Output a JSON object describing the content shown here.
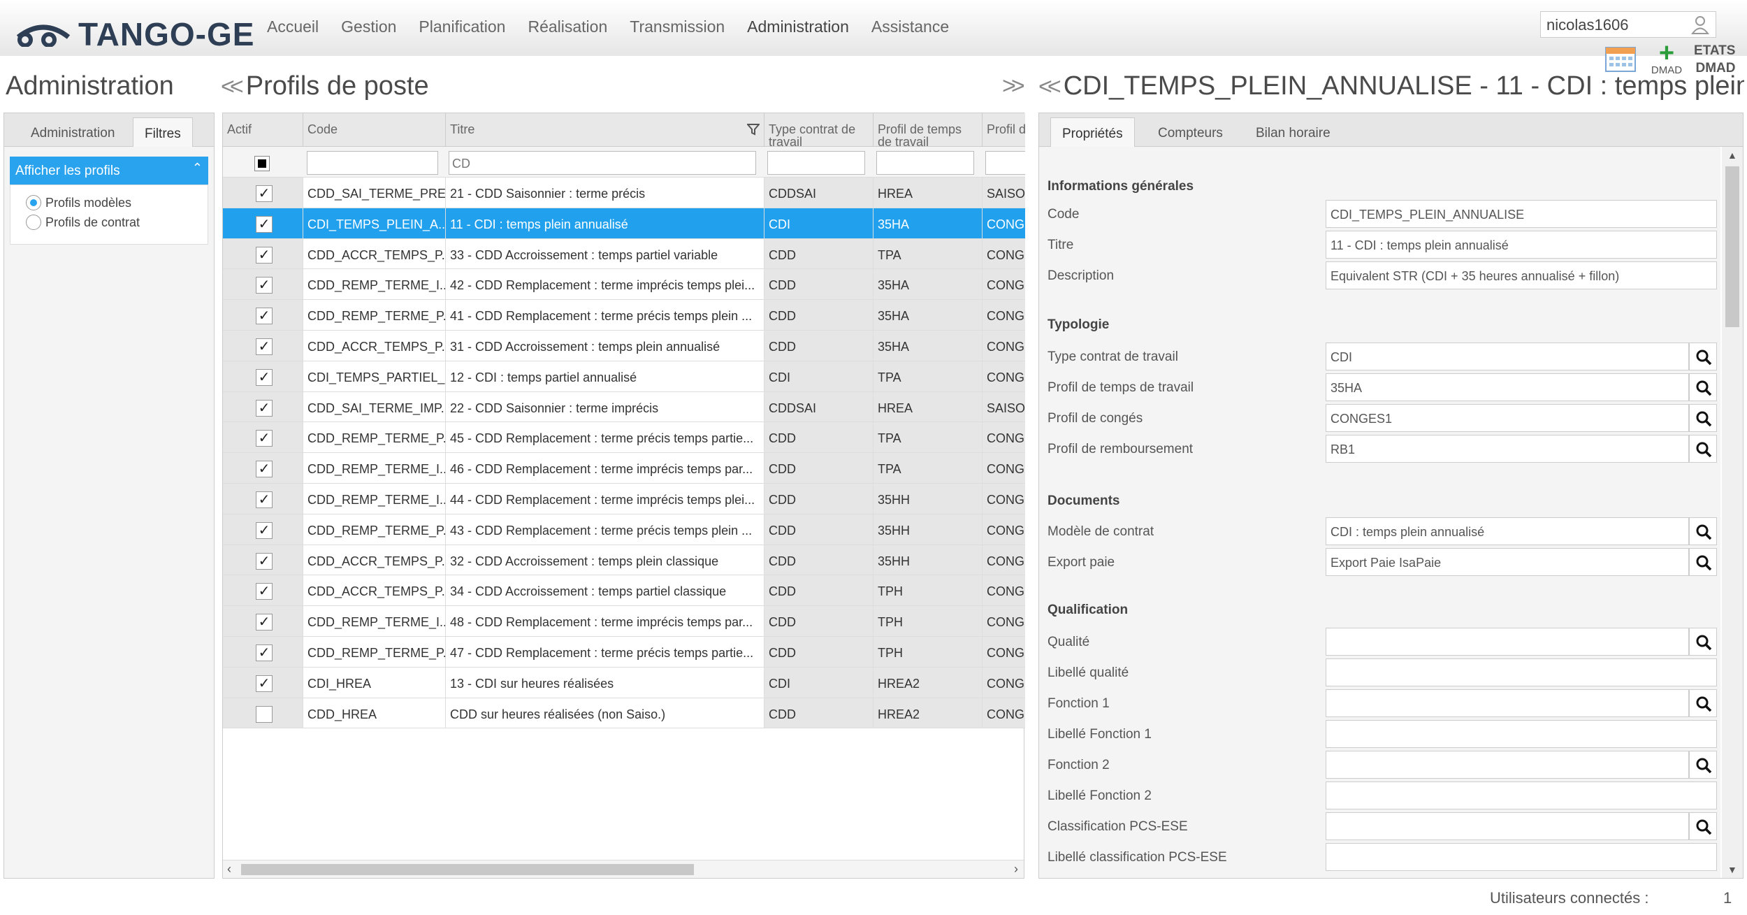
{
  "app": {
    "logo": "TANGO-GE"
  },
  "nav": [
    "Accueil",
    "Gestion",
    "Planification",
    "Réalisation",
    "Transmission",
    "Administration",
    "Assistance"
  ],
  "user": "nicolas1606",
  "toolbar": {
    "dmad": "DMAD",
    "etats": "ETATS",
    "dmad2": "DMAD"
  },
  "titles": {
    "left": "Administration",
    "middle": "Profils de poste",
    "right": "CDI_TEMPS_PLEIN_ANNUALISE - 11 - CDI : temps plein ..."
  },
  "left_tabs": [
    "Administration",
    "Filtres"
  ],
  "filter": {
    "header": "Afficher les profils",
    "options": [
      "Profils modèles",
      "Profils de contrat"
    ],
    "selected": 0
  },
  "grid": {
    "columns": [
      "Actif",
      "Code",
      "Titre",
      "Type contrat de travail",
      "Profil de temps de travail",
      "Profil d"
    ],
    "filter_titre": "CD",
    "rows": [
      {
        "actif": true,
        "code": "CDD_SAI_TERME_PRE...",
        "titre": "21 - CDD Saisonnier : terme précis",
        "type": "CDDSAI",
        "profil": "HREA",
        "conge": "SAISO"
      },
      {
        "actif": true,
        "code": "CDI_TEMPS_PLEIN_A...",
        "titre": "11 - CDI : temps plein annualisé",
        "type": "CDI",
        "profil": "35HA",
        "conge": "CONG",
        "selected": true
      },
      {
        "actif": true,
        "code": "CDD_ACCR_TEMPS_P...",
        "titre": "33 - CDD Accroissement : temps partiel variable",
        "type": "CDD",
        "profil": "TPA",
        "conge": "CONG"
      },
      {
        "actif": true,
        "code": "CDD_REMP_TERME_I...",
        "titre": "42 - CDD Remplacement : terme imprécis temps plei...",
        "type": "CDD",
        "profil": "35HA",
        "conge": "CONG"
      },
      {
        "actif": true,
        "code": "CDD_REMP_TERME_P...",
        "titre": "41 - CDD Remplacement : terme précis temps plein ...",
        "type": "CDD",
        "profil": "35HA",
        "conge": "CONG"
      },
      {
        "actif": true,
        "code": "CDD_ACCR_TEMPS_P...",
        "titre": "31 - CDD Accroissement : temps plein annualisé",
        "type": "CDD",
        "profil": "35HA",
        "conge": "CONG"
      },
      {
        "actif": true,
        "code": "CDI_TEMPS_PARTIEL_...",
        "titre": "12 - CDI : temps partiel annualisé",
        "type": "CDI",
        "profil": "TPA",
        "conge": "CONG"
      },
      {
        "actif": true,
        "code": "CDD_SAI_TERME_IMP...",
        "titre": "22 - CDD Saisonnier : terme imprécis",
        "type": "CDDSAI",
        "profil": "HREA",
        "conge": "SAISO"
      },
      {
        "actif": true,
        "code": "CDD_REMP_TERME_P...",
        "titre": "45 - CDD Remplacement : terme précis temps partie...",
        "type": "CDD",
        "profil": "TPA",
        "conge": "CONG"
      },
      {
        "actif": true,
        "code": "CDD_REMP_TERME_I...",
        "titre": "46 - CDD Remplacement : terme imprécis temps par...",
        "type": "CDD",
        "profil": "TPA",
        "conge": "CONG"
      },
      {
        "actif": true,
        "code": "CDD_REMP_TERME_I...",
        "titre": "44 - CDD Remplacement : terme imprécis temps plei...",
        "type": "CDD",
        "profil": "35HH",
        "conge": "CONG"
      },
      {
        "actif": true,
        "code": "CDD_REMP_TERME_P...",
        "titre": "43 - CDD Remplacement : terme précis temps plein ...",
        "type": "CDD",
        "profil": "35HH",
        "conge": "CONG"
      },
      {
        "actif": true,
        "code": "CDD_ACCR_TEMPS_P...",
        "titre": "32 - CDD Accroissement : temps plein classique",
        "type": "CDD",
        "profil": "35HH",
        "conge": "CONG"
      },
      {
        "actif": true,
        "code": "CDD_ACCR_TEMPS_P...",
        "titre": "34 - CDD Accroissement : temps partiel classique",
        "type": "CDD",
        "profil": "TPH",
        "conge": "CONG"
      },
      {
        "actif": true,
        "code": "CDD_REMP_TERME_I...",
        "titre": "48 - CDD Remplacement : terme imprécis temps par...",
        "type": "CDD",
        "profil": "TPH",
        "conge": "CONG"
      },
      {
        "actif": true,
        "code": "CDD_REMP_TERME_P...",
        "titre": "47 - CDD Remplacement : terme précis temps partie...",
        "type": "CDD",
        "profil": "TPH",
        "conge": "CONG"
      },
      {
        "actif": true,
        "code": "CDI_HREA",
        "titre": "13 - CDI sur heures réalisées",
        "type": "CDI",
        "profil": "HREA2",
        "conge": "CONG"
      },
      {
        "actif": false,
        "code": "CDD_HREA",
        "titre": "CDD sur heures réalisées (non Saiso.)",
        "type": "CDD",
        "profil": "HREA2",
        "conge": "CONG"
      }
    ]
  },
  "right_tabs": [
    "Propriétés",
    "Compteurs",
    "Bilan horaire"
  ],
  "props": {
    "sections": {
      "general": "Informations générales",
      "typo": "Typologie",
      "docs": "Documents",
      "qualif": "Qualification"
    },
    "fields": [
      {
        "label": "Code",
        "value": "CDI_TEMPS_PLEIN_ANNUALISE",
        "search": false
      },
      {
        "label": "Titre",
        "value": "11 - CDI : temps plein annualisé",
        "search": false
      },
      {
        "label": "Description",
        "value": "Equivalent STR (CDI + 35 heures annualisé + fillon)",
        "search": false
      },
      {
        "label": "Type contrat de travail",
        "value": "CDI",
        "search": true
      },
      {
        "label": "Profil de temps de travail",
        "value": "35HA",
        "search": true
      },
      {
        "label": "Profil de congés",
        "value": "CONGES1",
        "search": true
      },
      {
        "label": "Profil de remboursement",
        "value": "RB1",
        "search": true
      },
      {
        "label": "Modèle de contrat",
        "value": "CDI : temps plein annualisé",
        "search": true
      },
      {
        "label": "Export paie",
        "value": "Export Paie IsaPaie",
        "search": true
      },
      {
        "label": "Qualité",
        "value": "",
        "search": true
      },
      {
        "label": "Libellé qualité",
        "value": "",
        "search": false
      },
      {
        "label": "Fonction 1",
        "value": "",
        "search": true
      },
      {
        "label": "Libellé Fonction 1",
        "value": "",
        "search": false
      },
      {
        "label": "Fonction 2",
        "value": "",
        "search": true
      },
      {
        "label": "Libellé Fonction 2",
        "value": "",
        "search": false
      },
      {
        "label": "Classification PCS-ESE",
        "value": "",
        "search": true
      },
      {
        "label": "Libellé classification PCS-ESE",
        "value": "",
        "search": false
      }
    ]
  },
  "footer": {
    "label": "Utilisateurs connectés :",
    "count": "1"
  },
  "colors": {
    "accent": "#21a0ee",
    "brand": "#2d3e55",
    "plus": "#2a9d3a"
  }
}
